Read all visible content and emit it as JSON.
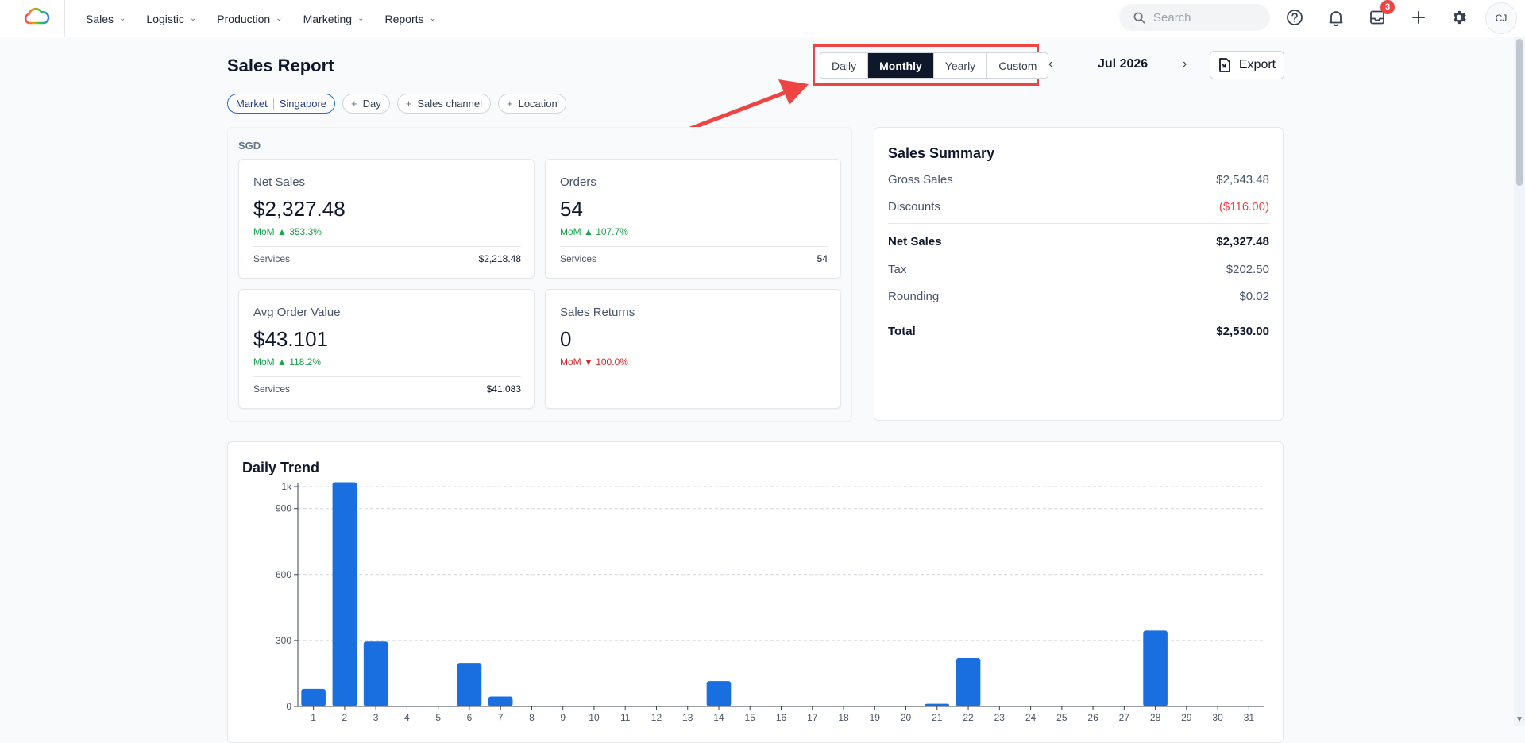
{
  "nav": {
    "items": [
      {
        "label": "Sales"
      },
      {
        "label": "Logistic"
      },
      {
        "label": "Production"
      },
      {
        "label": "Marketing"
      },
      {
        "label": "Reports"
      }
    ],
    "search_placeholder": "Search",
    "inbox_badge": "3",
    "avatar_initials": "CJ"
  },
  "header": {
    "title": "Sales Report",
    "filters": {
      "market_key": "Market",
      "market_value": "Singapore",
      "add": [
        "Day",
        "Sales channel",
        "Location"
      ]
    },
    "period_modes": [
      "Daily",
      "Monthly",
      "Yearly",
      "Custom"
    ],
    "selected_mode": "Monthly",
    "period": "Jul 2026",
    "export_label": "Export"
  },
  "kpi": {
    "currency": "SGD",
    "cards": [
      {
        "label": "Net Sales",
        "value": "$2,327.48",
        "delta": "MoM ▲ 353.3%",
        "trend": "up",
        "sub_label": "Services",
        "sub_value": "$2,218.48"
      },
      {
        "label": "Orders",
        "value": "54",
        "delta": "MoM ▲ 107.7%",
        "trend": "up",
        "sub_label": "Services",
        "sub_value": "54"
      },
      {
        "label": "Avg Order Value",
        "value": "$43.101",
        "delta": "MoM ▲ 118.2%",
        "trend": "up",
        "sub_label": "Services",
        "sub_value": "$41.083"
      },
      {
        "label": "Sales Returns",
        "value": "0",
        "delta": "MoM ▼ 100.0%",
        "trend": "down"
      }
    ]
  },
  "summary": {
    "title": "Sales Summary",
    "rows": [
      {
        "label": "Gross Sales",
        "value": "$2,543.48"
      },
      {
        "label": "Discounts",
        "value": "($116.00)"
      },
      {
        "label": "Net Sales",
        "value": "$2,327.48"
      },
      {
        "label": "Tax",
        "value": "$202.50"
      },
      {
        "label": "Rounding",
        "value": "$0.02"
      },
      {
        "label": "Total",
        "value": "$2,530.00"
      }
    ]
  },
  "colors": {
    "accent": "#1e6fd9",
    "bar": "#1a6fe0",
    "highlight": "#ef4444",
    "up": "#16a34a",
    "down": "#dc2626"
  },
  "chart_data": {
    "type": "bar",
    "title": "Daily Trend",
    "categories": [
      "1",
      "2",
      "3",
      "4",
      "5",
      "6",
      "7",
      "8",
      "9",
      "10",
      "11",
      "12",
      "13",
      "14",
      "15",
      "16",
      "17",
      "18",
      "19",
      "20",
      "21",
      "22",
      "23",
      "24",
      "25",
      "26",
      "27",
      "28",
      "29",
      "30",
      "31"
    ],
    "values": [
      80,
      1020,
      295,
      0,
      0,
      198,
      45,
      0,
      0,
      0,
      0,
      0,
      0,
      115,
      0,
      0,
      0,
      0,
      0,
      0,
      12,
      220,
      0,
      0,
      0,
      0,
      0,
      345,
      0,
      0,
      0
    ],
    "ylim": [
      0,
      1000
    ],
    "yticks": [
      0,
      300,
      600,
      900,
      1000
    ],
    "ytick_labels": [
      "0",
      "300",
      "600",
      "900",
      "1k"
    ],
    "grid": true
  }
}
